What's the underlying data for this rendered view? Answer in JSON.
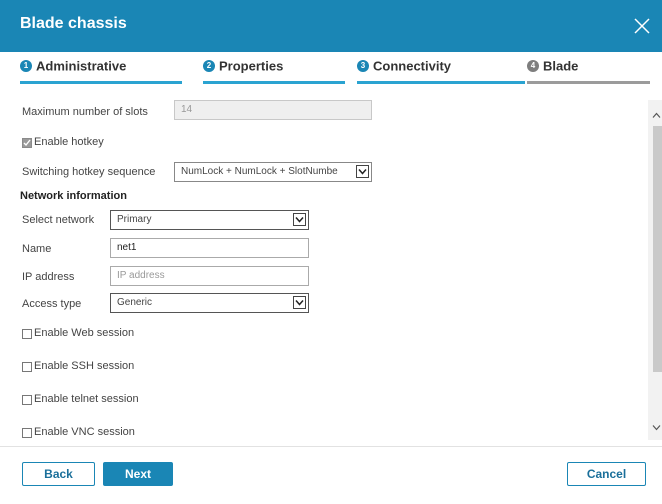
{
  "dialog": {
    "title": "Blade chassis"
  },
  "steps": [
    {
      "num": "1",
      "label": "Administrative"
    },
    {
      "num": "2",
      "label": "Properties"
    },
    {
      "num": "3",
      "label": "Connectivity"
    },
    {
      "num": "4",
      "label": "Blade"
    }
  ],
  "form": {
    "max_slots_label": "Maximum number of slots",
    "max_slots_value": "14",
    "enable_hotkey_label": "Enable hotkey",
    "enable_hotkey_checked": true,
    "hotkey_seq_label": "Switching hotkey sequence",
    "hotkey_seq_value": "NumLock + NumLock + SlotNumbe",
    "network_section": "Network information",
    "select_network_label": "Select network",
    "select_network_value": "Primary",
    "name_label": "Name",
    "name_value": "net1",
    "ip_label": "IP address",
    "ip_placeholder": "IP address",
    "access_type_label": "Access type",
    "access_type_value": "Generic",
    "web_session_label": "Enable Web session",
    "ssh_session_label": "Enable SSH session",
    "telnet_session_label": "Enable telnet session",
    "vnc_session_label": "Enable VNC session"
  },
  "buttons": {
    "back": "Back",
    "next": "Next",
    "cancel": "Cancel"
  },
  "colors": {
    "accent": "#1a86b5",
    "step_active_bar": "#2aa3d1",
    "step_inactive_bar": "#9b9b9b"
  },
  "icons": {
    "close": "close-icon",
    "scroll_up": "chevron-up-icon",
    "scroll_down": "chevron-down-icon",
    "dropdown": "chevron-down-icon"
  }
}
